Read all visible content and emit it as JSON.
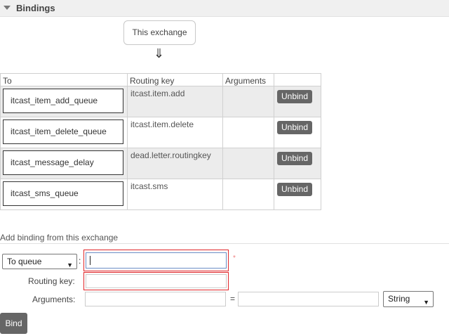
{
  "section": {
    "title": "Bindings",
    "toggle_icon": "triangle-down-icon"
  },
  "exchange_label": "This exchange",
  "arrow_glyph": "⇓",
  "table": {
    "headers": [
      "To",
      "Routing key",
      "Arguments",
      ""
    ],
    "rows": [
      {
        "to": "itcast_item_add_queue",
        "routing_key": "itcast.item.add",
        "arguments": "",
        "action": "Unbind"
      },
      {
        "to": "itcast_item_delete_queue",
        "routing_key": "itcast.item.delete",
        "arguments": "",
        "action": "Unbind"
      },
      {
        "to": "itcast_message_delay",
        "routing_key": "dead.letter.routingkey",
        "arguments": "",
        "action": "Unbind"
      },
      {
        "to": "itcast_sms_queue",
        "routing_key": "itcast.sms",
        "arguments": "",
        "action": "Unbind"
      }
    ]
  },
  "add_binding": {
    "title": "Add binding from this exchange",
    "destination_type": "To queue",
    "colon": ":",
    "destination_value": "",
    "required_marker": "*",
    "routing_key_label": "Routing key:",
    "routing_key_value": "",
    "arguments_label": "Arguments:",
    "argument_key_value": "",
    "equals": "=",
    "argument_value": "",
    "argument_type": "String",
    "bind_label": "Bind"
  },
  "colors": {
    "unbind_bg": "#666666",
    "highlight_border": "#e0262a",
    "header_bg": "#f0f0f0"
  }
}
